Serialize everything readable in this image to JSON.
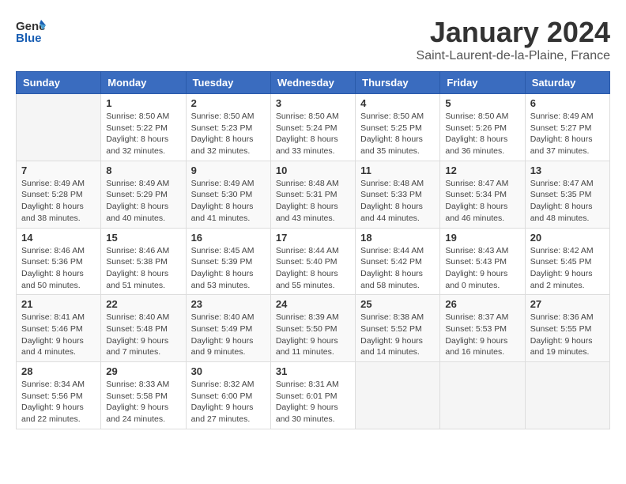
{
  "header": {
    "logo": {
      "general": "General",
      "blue": "Blue"
    },
    "title": "January 2024",
    "location": "Saint-Laurent-de-la-Plaine, France"
  },
  "weekdays": [
    "Sunday",
    "Monday",
    "Tuesday",
    "Wednesday",
    "Thursday",
    "Friday",
    "Saturday"
  ],
  "weeks": [
    [
      {
        "day": "",
        "info": ""
      },
      {
        "day": "1",
        "info": "Sunrise: 8:50 AM\nSunset: 5:22 PM\nDaylight: 8 hours\nand 32 minutes."
      },
      {
        "day": "2",
        "info": "Sunrise: 8:50 AM\nSunset: 5:23 PM\nDaylight: 8 hours\nand 32 minutes."
      },
      {
        "day": "3",
        "info": "Sunrise: 8:50 AM\nSunset: 5:24 PM\nDaylight: 8 hours\nand 33 minutes."
      },
      {
        "day": "4",
        "info": "Sunrise: 8:50 AM\nSunset: 5:25 PM\nDaylight: 8 hours\nand 35 minutes."
      },
      {
        "day": "5",
        "info": "Sunrise: 8:50 AM\nSunset: 5:26 PM\nDaylight: 8 hours\nand 36 minutes."
      },
      {
        "day": "6",
        "info": "Sunrise: 8:49 AM\nSunset: 5:27 PM\nDaylight: 8 hours\nand 37 minutes."
      }
    ],
    [
      {
        "day": "7",
        "info": "Sunrise: 8:49 AM\nSunset: 5:28 PM\nDaylight: 8 hours\nand 38 minutes."
      },
      {
        "day": "8",
        "info": "Sunrise: 8:49 AM\nSunset: 5:29 PM\nDaylight: 8 hours\nand 40 minutes."
      },
      {
        "day": "9",
        "info": "Sunrise: 8:49 AM\nSunset: 5:30 PM\nDaylight: 8 hours\nand 41 minutes."
      },
      {
        "day": "10",
        "info": "Sunrise: 8:48 AM\nSunset: 5:31 PM\nDaylight: 8 hours\nand 43 minutes."
      },
      {
        "day": "11",
        "info": "Sunrise: 8:48 AM\nSunset: 5:33 PM\nDaylight: 8 hours\nand 44 minutes."
      },
      {
        "day": "12",
        "info": "Sunrise: 8:47 AM\nSunset: 5:34 PM\nDaylight: 8 hours\nand 46 minutes."
      },
      {
        "day": "13",
        "info": "Sunrise: 8:47 AM\nSunset: 5:35 PM\nDaylight: 8 hours\nand 48 minutes."
      }
    ],
    [
      {
        "day": "14",
        "info": "Sunrise: 8:46 AM\nSunset: 5:36 PM\nDaylight: 8 hours\nand 50 minutes."
      },
      {
        "day": "15",
        "info": "Sunrise: 8:46 AM\nSunset: 5:38 PM\nDaylight: 8 hours\nand 51 minutes."
      },
      {
        "day": "16",
        "info": "Sunrise: 8:45 AM\nSunset: 5:39 PM\nDaylight: 8 hours\nand 53 minutes."
      },
      {
        "day": "17",
        "info": "Sunrise: 8:44 AM\nSunset: 5:40 PM\nDaylight: 8 hours\nand 55 minutes."
      },
      {
        "day": "18",
        "info": "Sunrise: 8:44 AM\nSunset: 5:42 PM\nDaylight: 8 hours\nand 58 minutes."
      },
      {
        "day": "19",
        "info": "Sunrise: 8:43 AM\nSunset: 5:43 PM\nDaylight: 9 hours\nand 0 minutes."
      },
      {
        "day": "20",
        "info": "Sunrise: 8:42 AM\nSunset: 5:45 PM\nDaylight: 9 hours\nand 2 minutes."
      }
    ],
    [
      {
        "day": "21",
        "info": "Sunrise: 8:41 AM\nSunset: 5:46 PM\nDaylight: 9 hours\nand 4 minutes."
      },
      {
        "day": "22",
        "info": "Sunrise: 8:40 AM\nSunset: 5:48 PM\nDaylight: 9 hours\nand 7 minutes."
      },
      {
        "day": "23",
        "info": "Sunrise: 8:40 AM\nSunset: 5:49 PM\nDaylight: 9 hours\nand 9 minutes."
      },
      {
        "day": "24",
        "info": "Sunrise: 8:39 AM\nSunset: 5:50 PM\nDaylight: 9 hours\nand 11 minutes."
      },
      {
        "day": "25",
        "info": "Sunrise: 8:38 AM\nSunset: 5:52 PM\nDaylight: 9 hours\nand 14 minutes."
      },
      {
        "day": "26",
        "info": "Sunrise: 8:37 AM\nSunset: 5:53 PM\nDaylight: 9 hours\nand 16 minutes."
      },
      {
        "day": "27",
        "info": "Sunrise: 8:36 AM\nSunset: 5:55 PM\nDaylight: 9 hours\nand 19 minutes."
      }
    ],
    [
      {
        "day": "28",
        "info": "Sunrise: 8:34 AM\nSunset: 5:56 PM\nDaylight: 9 hours\nand 22 minutes."
      },
      {
        "day": "29",
        "info": "Sunrise: 8:33 AM\nSunset: 5:58 PM\nDaylight: 9 hours\nand 24 minutes."
      },
      {
        "day": "30",
        "info": "Sunrise: 8:32 AM\nSunset: 6:00 PM\nDaylight: 9 hours\nand 27 minutes."
      },
      {
        "day": "31",
        "info": "Sunrise: 8:31 AM\nSunset: 6:01 PM\nDaylight: 9 hours\nand 30 minutes."
      },
      {
        "day": "",
        "info": ""
      },
      {
        "day": "",
        "info": ""
      },
      {
        "day": "",
        "info": ""
      }
    ]
  ]
}
